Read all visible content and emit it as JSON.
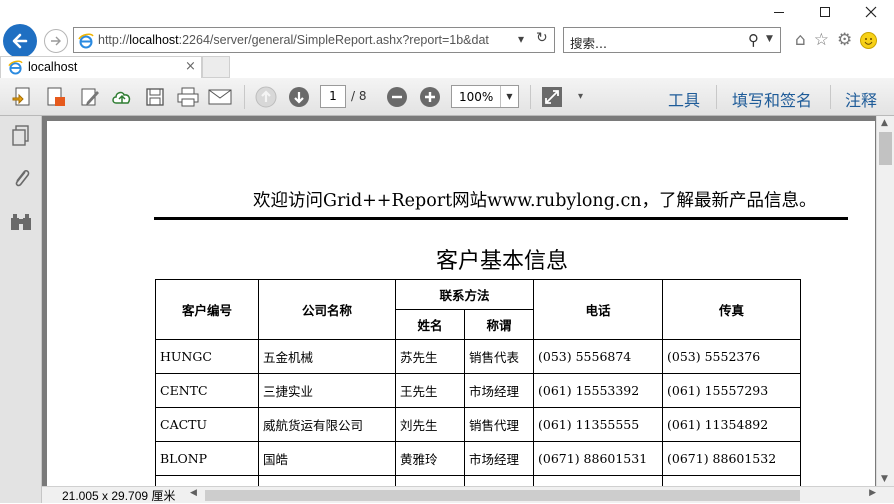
{
  "window": {
    "minimize_label": "",
    "controls": [
      "minimize",
      "maximize",
      "close"
    ]
  },
  "address_bar": {
    "url_prefix": "http://",
    "url_host": "localhost",
    "url_rest": ":2264/server/general/SimpleReport.ashx?report=1b&dat",
    "refresh_icon": "refresh-icon"
  },
  "search": {
    "placeholder": "搜索..."
  },
  "tab": {
    "title": "localhost"
  },
  "pdf_toolbar": {
    "page_current": "1",
    "page_total": "/ 8",
    "zoom": "100%",
    "tools_label": "工具",
    "sign_label": "填写和签名",
    "comment_label": "注释"
  },
  "report": {
    "welcome": "欢迎访问Grid++Report网站www.rubylong.cn，了解最新产品信息。",
    "title": "客户基本信息",
    "headers": {
      "customer_id": "客户编号",
      "company": "公司名称",
      "contact_group": "联系方法",
      "name": "姓名",
      "role": "称谓",
      "phone": "电话",
      "fax": "传真"
    },
    "rows": [
      {
        "id": "HUNGC",
        "company": "五金机械",
        "name": "苏先生",
        "role": "销售代表",
        "phone": "(053) 5556874",
        "fax": "(053) 5552376"
      },
      {
        "id": "CENTC",
        "company": "三捷实业",
        "name": "王先生",
        "role": "市场经理",
        "phone": "(061) 15553392",
        "fax": "(061) 15557293"
      },
      {
        "id": "CACTU",
        "company": "威航货运有限公司",
        "name": "刘先生",
        "role": "销售代理",
        "phone": "(061) 11355555",
        "fax": "(061) 11354892"
      },
      {
        "id": "BLONP",
        "company": "国皓",
        "name": "黄雅玲",
        "role": "市场经理",
        "phone": "(0671) 88601531",
        "fax": "(0671) 88601532"
      }
    ]
  },
  "status": {
    "page_size": "21.005 x 29.709 厘米"
  }
}
